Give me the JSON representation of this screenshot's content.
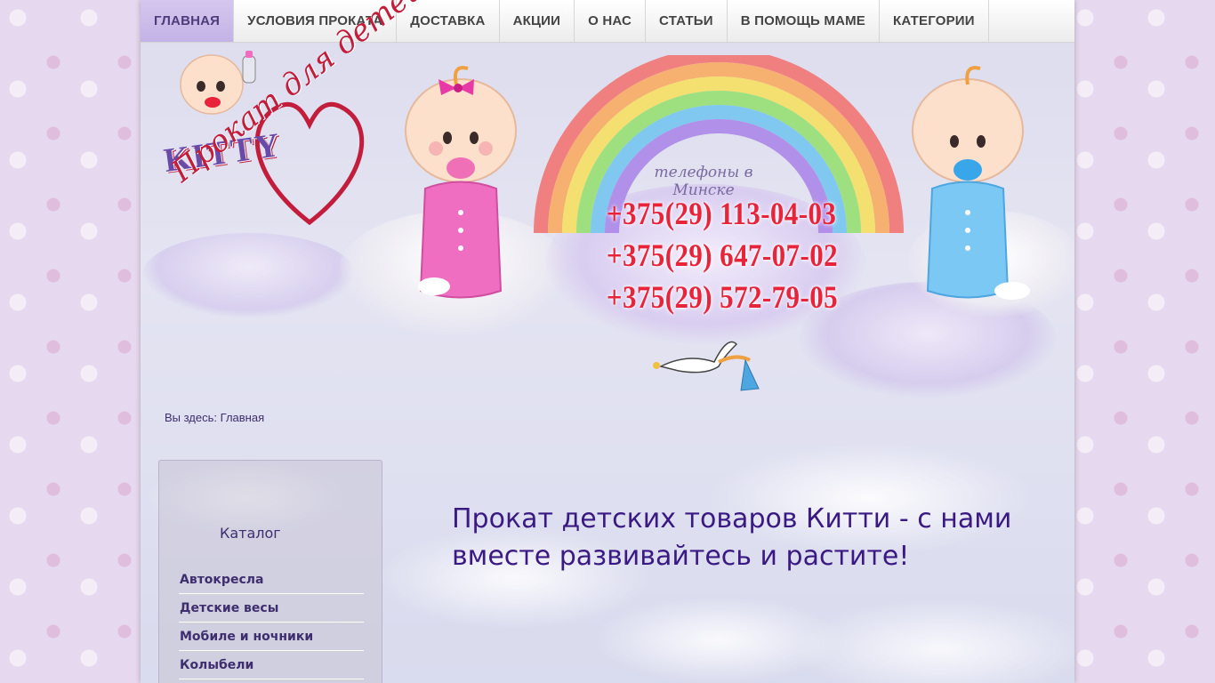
{
  "nav": {
    "items": [
      {
        "label": "ГЛАВНАЯ",
        "active": true
      },
      {
        "label": "УСЛОВИЯ ПРОКАТА"
      },
      {
        "label": "ДОСТАВКА"
      },
      {
        "label": "АКЦИИ"
      },
      {
        "label": "О НАС"
      },
      {
        "label": "СТАТЬИ"
      },
      {
        "label": "В ПОМОЩЬ МАМЕ"
      },
      {
        "label": "КАТЕГОРИИ"
      }
    ]
  },
  "logo": {
    "brand": "KITTY",
    "sub": "ПРОКАТ",
    "script": "Прокат для детей"
  },
  "header": {
    "phone_caption": "телефоны в Минске",
    "phones": [
      "+375(29) 113-04-03",
      "+375(29) 647-07-02",
      "+375(29) 572-79-05"
    ]
  },
  "breadcrumb": {
    "prefix": "Вы здесь:",
    "current": "Главная"
  },
  "sidebar": {
    "title": "Каталог",
    "items": [
      "Автокресла",
      "Детские весы",
      "Мобиле и ночники",
      "Колыбели"
    ]
  },
  "main": {
    "headline": "Прокат детских товаров Китти - с нами вместе развивайтесь и растите!"
  },
  "colors": {
    "accent": "#3a1a82",
    "phone": "#e8243a",
    "nav_active": "#c3b2e6"
  }
}
